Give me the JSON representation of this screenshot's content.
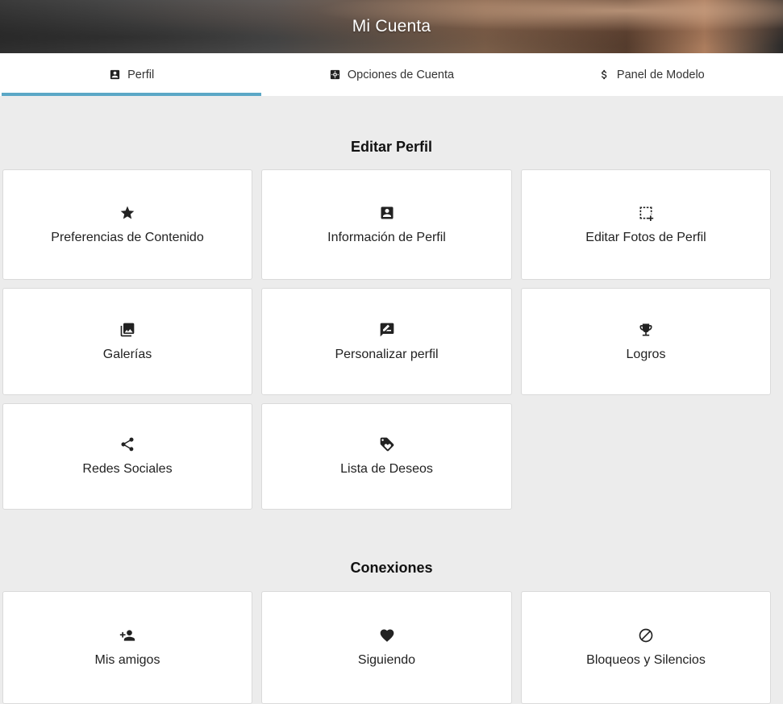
{
  "header": {
    "title": "Mi Cuenta"
  },
  "tabs": [
    {
      "label": "Perfil",
      "icon": "account-box-icon",
      "active": true
    },
    {
      "label": "Opciones de Cuenta",
      "icon": "settings-icon",
      "active": false
    },
    {
      "label": "Panel de Modelo",
      "icon": "dollar-icon",
      "active": false
    }
  ],
  "sections": {
    "edit_profile": {
      "title": "Editar Perfil",
      "cards": [
        {
          "label": "Preferencias de Contenido",
          "icon": "star-icon"
        },
        {
          "label": "Información de Perfil",
          "icon": "account-box-icon"
        },
        {
          "label": "Editar Fotos de Perfil",
          "icon": "crop-add-icon"
        },
        {
          "label": "Galerías",
          "icon": "photo-library-icon"
        },
        {
          "label": "Personalizar perfil",
          "icon": "edit-comment-icon"
        },
        {
          "label": "Logros",
          "icon": "trophy-icon"
        },
        {
          "label": "Redes Sociales",
          "icon": "share-icon"
        },
        {
          "label": "Lista de Deseos",
          "icon": "tag-heart-icon"
        }
      ]
    },
    "connections": {
      "title": "Conexiones",
      "cards": [
        {
          "label": "Mis amigos",
          "icon": "person-add-icon"
        },
        {
          "label": "Siguiendo",
          "icon": "heart-icon"
        },
        {
          "label": "Bloqueos y Silencios",
          "icon": "block-icon"
        }
      ]
    }
  },
  "colors": {
    "accent": "#5ba7c6",
    "background": "#ececec"
  }
}
